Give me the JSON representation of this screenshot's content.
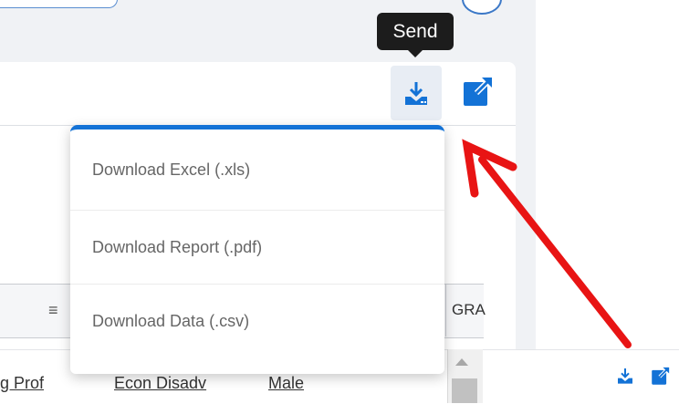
{
  "tooltip": {
    "text": "Send"
  },
  "dropdown": {
    "items": [
      {
        "label": "Download Excel (.xls)"
      },
      {
        "label": "Download Report (.pdf)"
      },
      {
        "label": "Download Data (.csv)"
      }
    ]
  },
  "table": {
    "header_menu_glyph": "≡",
    "partial_column_label": "GRA",
    "row_links": [
      "g Prof",
      "Econ Disadv",
      "Male"
    ]
  },
  "icons": {
    "download": "download-icon",
    "external": "external-link-icon"
  },
  "colors": {
    "accent": "#1372d6",
    "annotation_arrow": "#e81414",
    "tooltip_bg": "#1c1c1c"
  }
}
